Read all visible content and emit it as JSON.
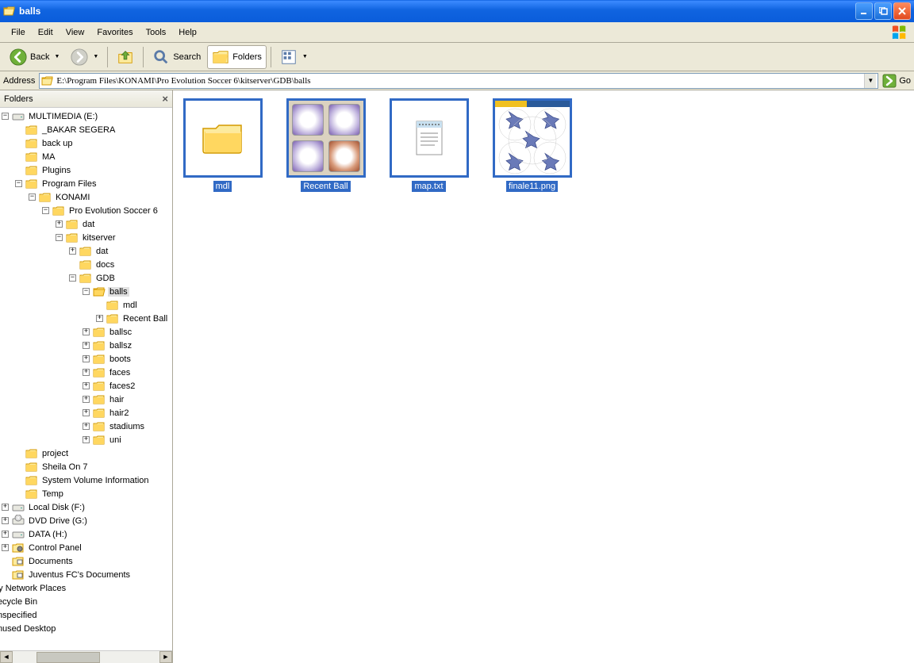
{
  "window": {
    "title": "balls"
  },
  "menu": {
    "file": "File",
    "edit": "Edit",
    "view": "View",
    "favorites": "Favorites",
    "tools": "Tools",
    "help": "Help"
  },
  "toolbar": {
    "back": "Back",
    "search": "Search",
    "folders": "Folders"
  },
  "addressbar": {
    "label": "Address",
    "path": "E:\\Program Files\\KONAMI\\Pro Evolution Soccer 6\\kitserver\\GDB\\balls",
    "go": "Go"
  },
  "sidebar": {
    "title": "Folders"
  },
  "tree": {
    "root": "MULTIMEDIA (E:)",
    "n1": "_BAKAR SEGERA",
    "n2": "back up",
    "n3": "MA",
    "n4": "Plugins",
    "n5": "Program Files",
    "konami": "KONAMI",
    "pes": "Pro Evolution Soccer 6",
    "dat": "dat",
    "kitserver": "kitserver",
    "dat2": "dat",
    "docs": "docs",
    "gdb": "GDB",
    "balls": "balls",
    "mdl": "mdl",
    "recent": "Recent Ball",
    "ballsc": "ballsc",
    "ballsz": "ballsz",
    "boots": "boots",
    "faces": "faces",
    "faces2": "faces2",
    "hair": "hair",
    "hair2": "hair2",
    "stadiums": "stadiums",
    "uni": "uni",
    "project": "project",
    "sheila": "Sheila On 7",
    "svi": "System Volume Information",
    "temp": "Temp",
    "localf": "Local Disk (F:)",
    "dvd": "DVD Drive (G:)",
    "datah": "DATA (H:)",
    "cp": "Control Panel",
    "docs2": "Documents",
    "juv": "Juventus FC's Documents",
    "mynet": "My Network Places",
    "recycle": "Recycle Bin",
    "unspec": "Unspecified",
    "unused": "Unused Desktop"
  },
  "items": {
    "mdl": "mdl",
    "recent": "Recent Ball",
    "map": "map.txt",
    "finale": "finale11.png"
  }
}
